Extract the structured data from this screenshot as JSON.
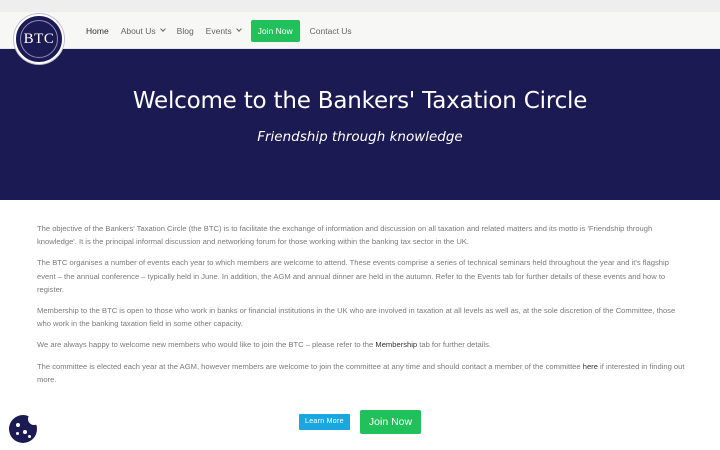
{
  "logo": {
    "text": "BTC",
    "ring_text": "BANKERS' TAXATION CIRCLE",
    "icon": "btc-seal-logo"
  },
  "nav": {
    "items": [
      {
        "label": "Home",
        "active": true
      },
      {
        "label": "About Us",
        "dropdown": true
      },
      {
        "label": "Blog"
      },
      {
        "label": "Events",
        "dropdown": true
      }
    ],
    "join_label": "Join Now",
    "contact_label": "Contact Us"
  },
  "hero": {
    "title": "Welcome to the Bankers' Taxation Circle",
    "subtitle": "Friendship through knowledge"
  },
  "content": {
    "p1": "The objective of the Bankers' Taxation Circle (the BTC) is to facilitate the exchange of information and discussion on all taxation and related matters and its motto is 'Friendship through knowledge'. It is the principal informal discussion and networking forum for those working within the banking tax sector in the UK.",
    "p2": "The BTC organises a number of events each year to which members are welcome to attend. These events comprise a series of technical seminars held throughout the year and it's flagship event – the annual conference – typically held in June. In addition, the AGM and annual dinner are held in the autumn. Refer to the Events tab for further details of these events and how to register.",
    "p3": "Membership to the BTC is open to those who work in banks or financial institutions in the UK who are involved in taxation at all levels as well as, at the sole discretion of the Committee, those who work in the banking taxation field in some other capacity.",
    "p4_before": "We are always happy to welcome new members who would like to join the BTC – please refer to the ",
    "p4_link": "Membership",
    "p4_after": " tab for further details.",
    "p5_before": "The committee is elected each year at the AGM, however members are welcome to join the committee at any time and should contact a member of the committee ",
    "p5_link": "here",
    "p5_after": " if interested in finding out more."
  },
  "buttons": {
    "learn_more": "Learn More",
    "join_now": "Join Now"
  },
  "cookie": {
    "icon": "cookie-icon"
  },
  "colors": {
    "navy": "#1c1a52",
    "green": "#20c05a",
    "blue": "#1aa7e0"
  }
}
